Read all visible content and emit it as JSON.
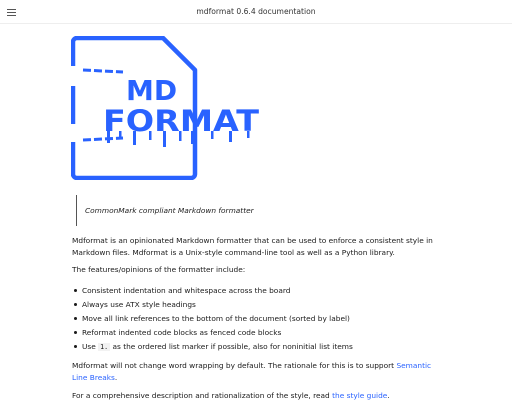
{
  "header": {
    "title": "mdformat 0.6.4 documentation",
    "menu_icon": "hamburger-menu-icon"
  },
  "logo": {
    "line1": "MD",
    "line2": "FORMAT",
    "color": "#2962ff"
  },
  "tagline": "CommonMark compliant Markdown formatter",
  "intro": "Mdformat is an opinionated Markdown formatter that can be used to enforce a consistent style in Markdown files. Mdformat is a Unix-style command-line tool as well as a Python library.",
  "features_intro": "The features/opinions of the formatter include:",
  "features": [
    "Consistent indentation and whitespace across the board",
    "Always use ATX style headings",
    "Move all link references to the bottom of the document (sorted by label)",
    "Reformat indented code blocks as fenced code blocks"
  ],
  "feature_last": {
    "prefix": "Use",
    "code": "1.",
    "suffix": "as the ordered list marker if possible, also for noninitial list items"
  },
  "wrapping": {
    "text": "Mdformat will not change word wrapping by default. The rationale for this is to support",
    "link": "Semantic Line Breaks",
    "end": "."
  },
  "style": {
    "text": "For a comprehensive description and rationalization of the style, read",
    "link": "the style guide",
    "end": "."
  }
}
